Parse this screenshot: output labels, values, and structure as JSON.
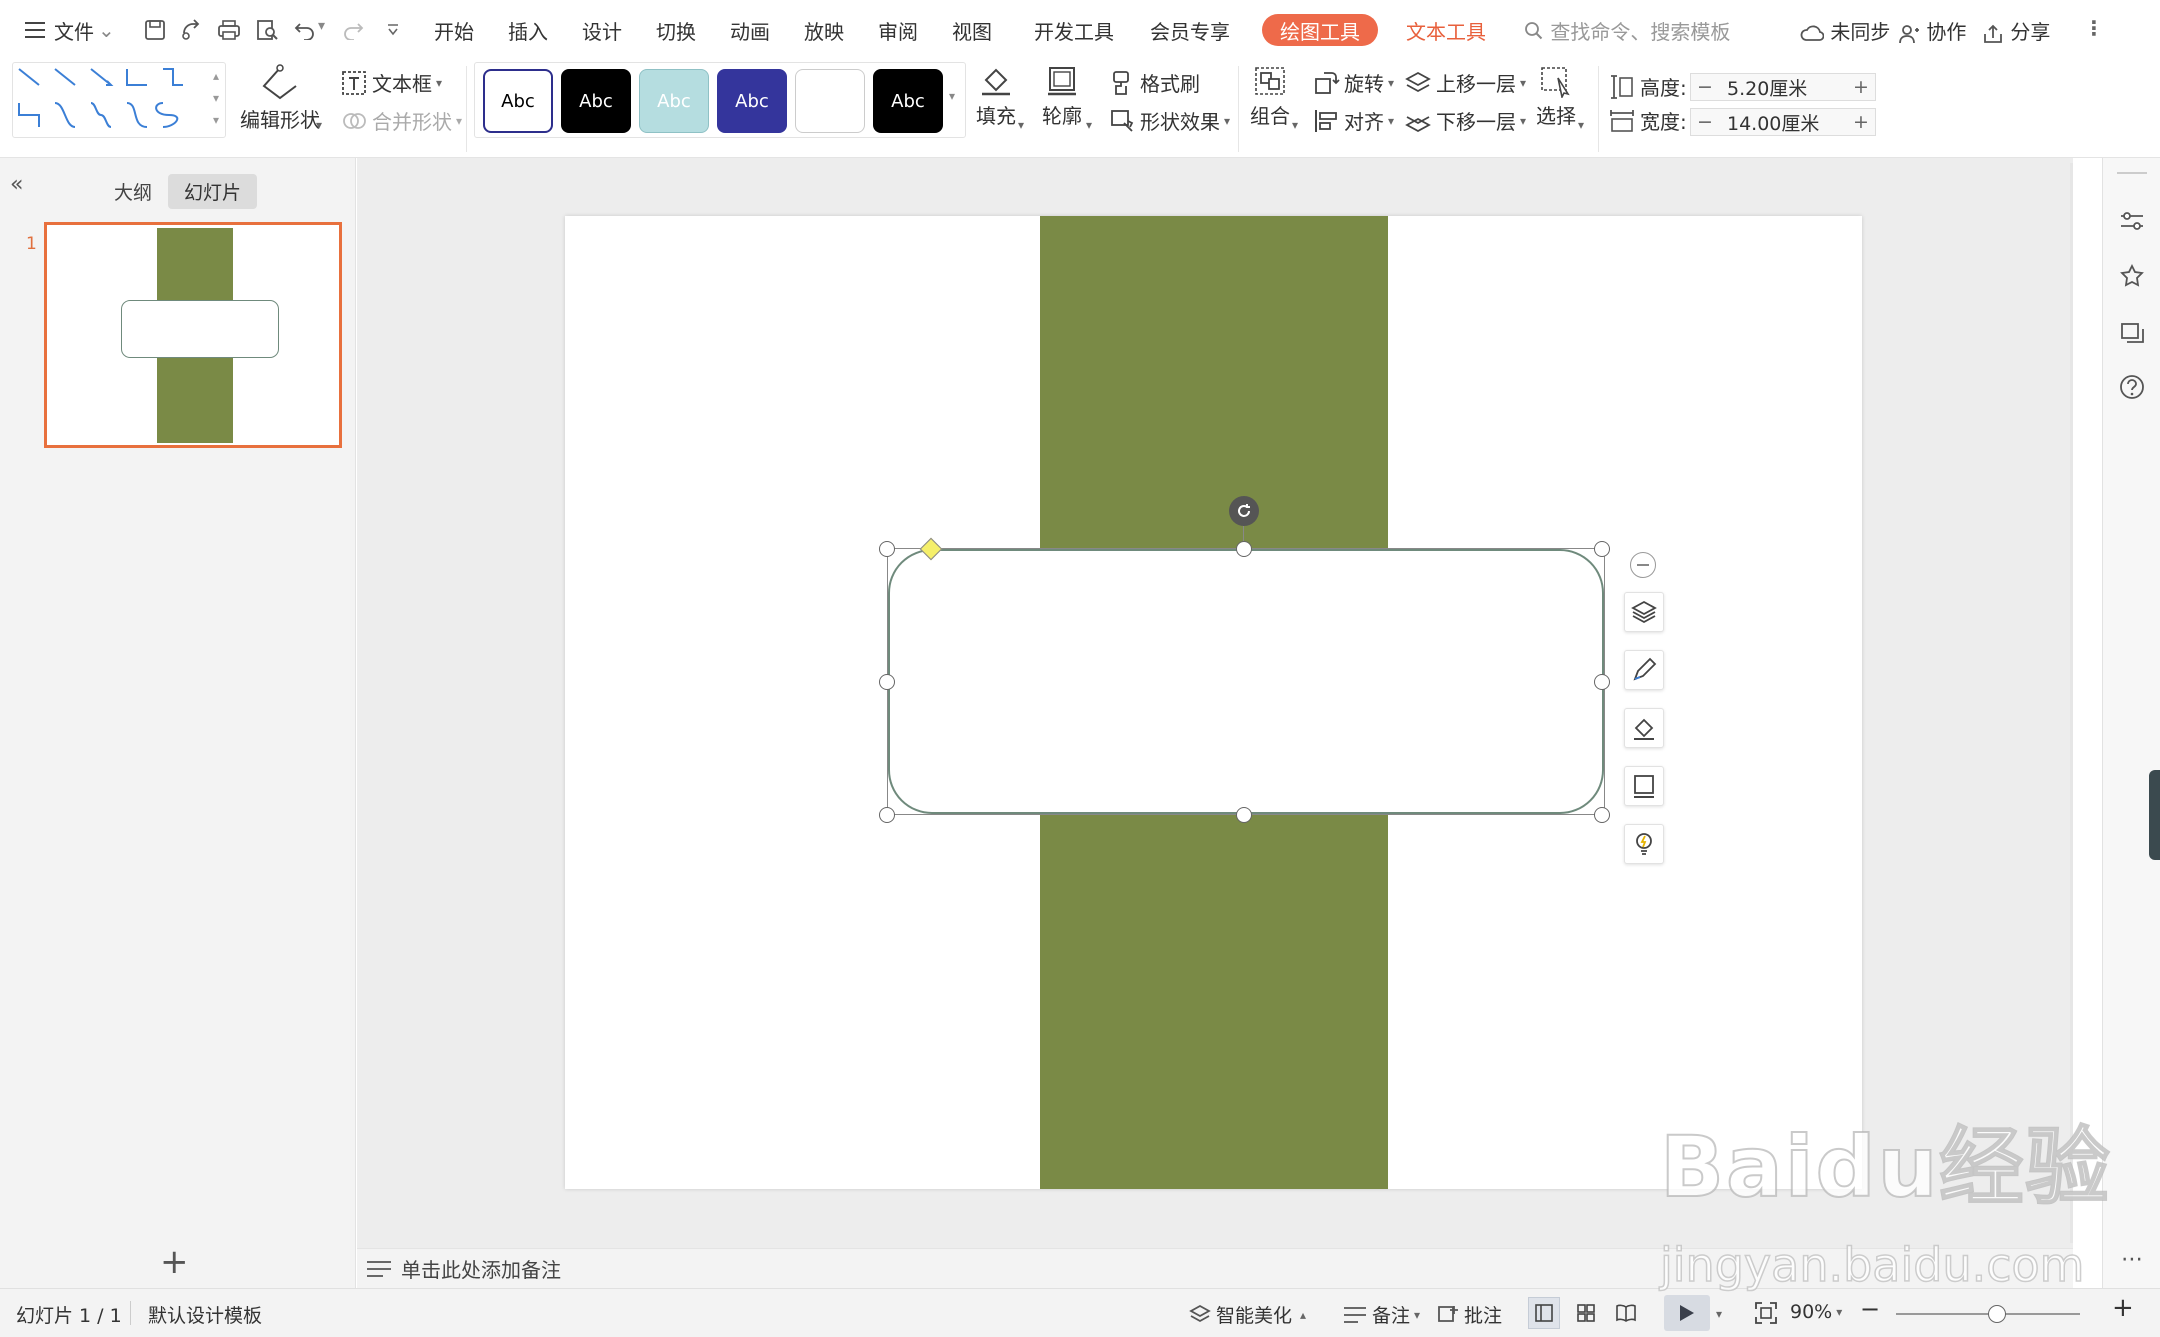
{
  "menubar": {
    "file_label": "文件",
    "tabs": [
      "开始",
      "插入",
      "设计",
      "切换",
      "动画",
      "放映",
      "审阅",
      "视图",
      "开发工具",
      "会员专享"
    ],
    "active_tab": "绘图工具",
    "text_tool_tab": "文本工具",
    "search_placeholder": "查找命令、搜索模板",
    "sync_label": "未同步",
    "collab_label": "协作",
    "share_label": "分享"
  },
  "ribbon": {
    "edit_shape": "编辑形状",
    "textbox": "文本框",
    "merge_shape": "合并形状",
    "style_presets": [
      "Abc",
      "Abc",
      "Abc",
      "Abc",
      "",
      "Abc"
    ],
    "fill": "填充",
    "outline": "轮廓",
    "format_painter": "格式刷",
    "shape_effect": "形状效果",
    "group": "组合",
    "rotate": "旋转",
    "align": "对齐",
    "bring_forward": "上移一层",
    "send_backward": "下移一层",
    "select": "选择",
    "height_label": "高度:",
    "height_value": "5.20厘米",
    "width_label": "宽度:",
    "width_value": "14.00厘米",
    "minus": "−",
    "plus": "+"
  },
  "leftpanel": {
    "outline_tab": "大纲",
    "slides_tab": "幻灯片",
    "slide_number": "1",
    "add_slide": "+"
  },
  "notes": {
    "placeholder": "单击此处添加备注"
  },
  "statusbar": {
    "slide_info": "幻灯片 1 / 1",
    "template": "默认设计模板",
    "beautify": "智能美化",
    "notes": "备注",
    "comments": "批注",
    "zoom": "90%",
    "zoom_fraction": 0.55
  },
  "watermark": {
    "brand": "Baidu经验",
    "url": "jingyan.baidu.com"
  },
  "colors": {
    "accent": "#ee6a4a",
    "band": "#7a8a46",
    "shape_border": "#6f8a7c",
    "selection": "#e8703d"
  }
}
